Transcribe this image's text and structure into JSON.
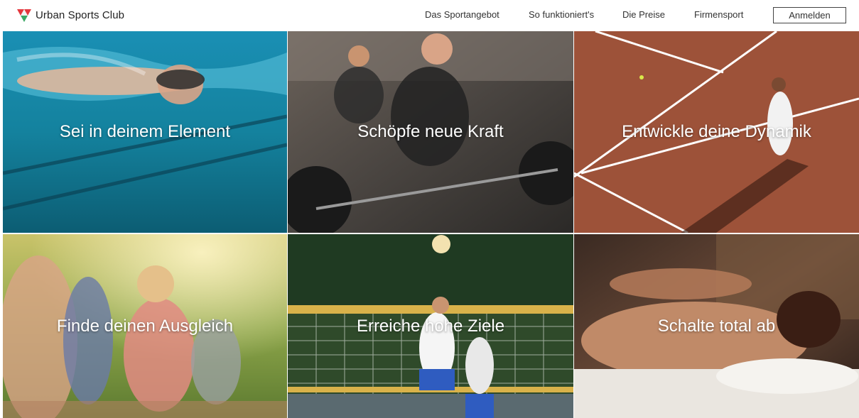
{
  "header": {
    "brand": "Urban Sports Club",
    "login_label": "Anmelden"
  },
  "nav": [
    {
      "label": "Das Sportangebot"
    },
    {
      "label": "So funktioniert's"
    },
    {
      "label": "Die Preise"
    },
    {
      "label": "Firmensport"
    }
  ],
  "tiles": [
    {
      "label": "Sei in deinem Element"
    },
    {
      "label": "Schöpfe neue Kraft"
    },
    {
      "label": "Entwickle deine Dynamik"
    },
    {
      "label": "Finde deinen Ausgleich"
    },
    {
      "label": "Erreiche hohe Ziele"
    },
    {
      "label": "Schalte total ab"
    }
  ],
  "colors": {
    "logo_red": "#e4373d",
    "logo_green": "#3aa864",
    "text": "#333333"
  }
}
